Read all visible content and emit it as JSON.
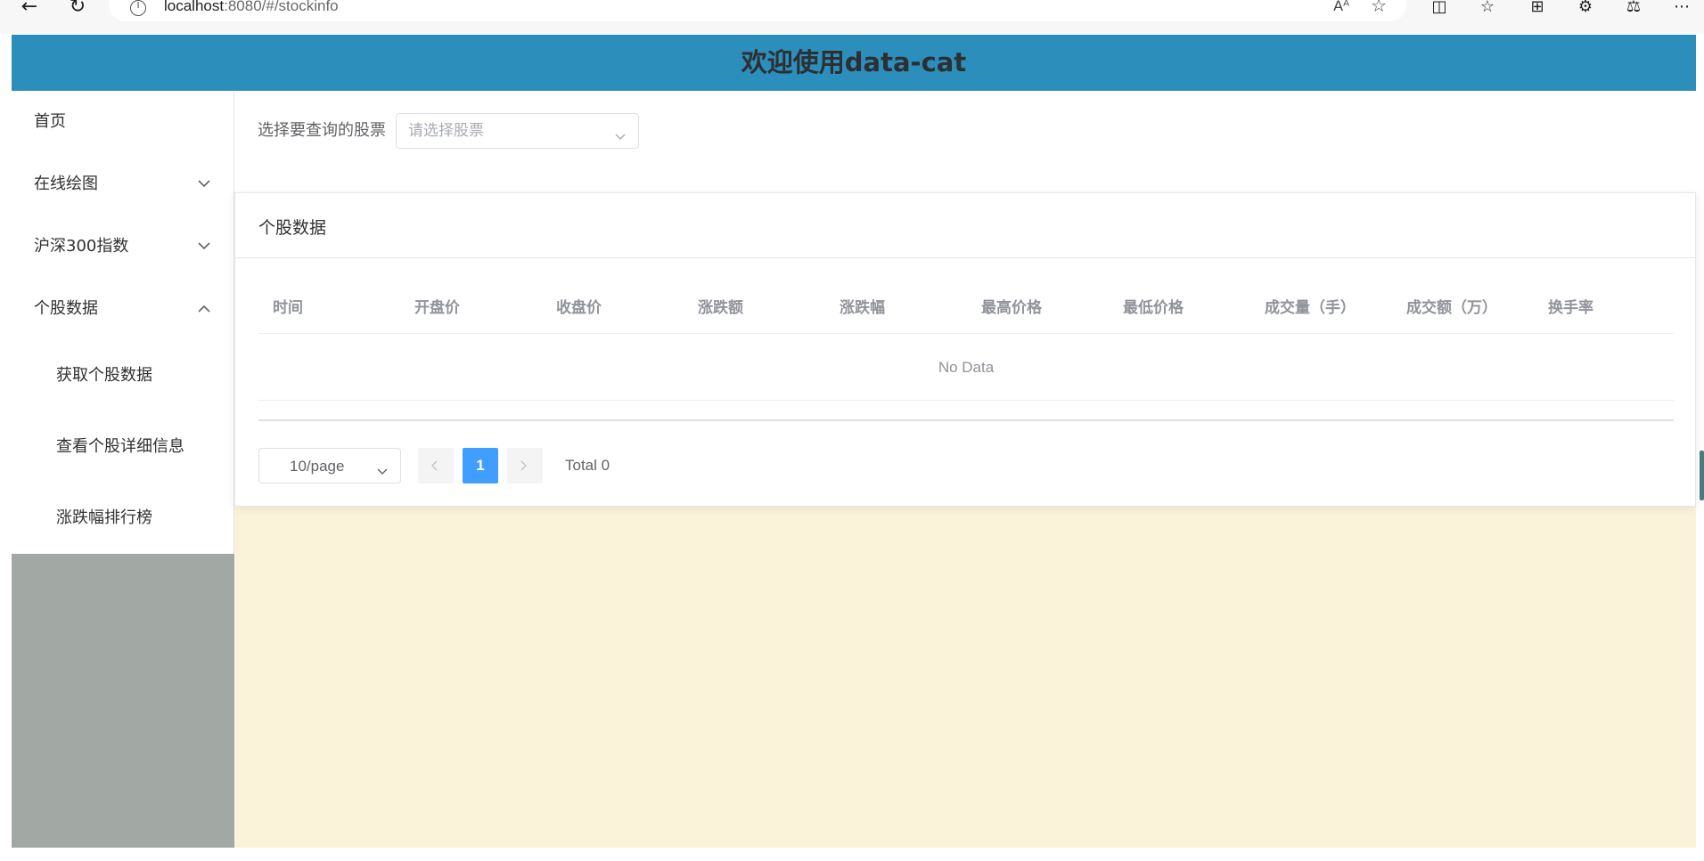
{
  "browser": {
    "url_host": "localhost",
    "url_rest": ":8080/#/stockinfo",
    "icons": [
      "back-icon",
      "refresh-icon",
      "info-icon",
      "read-aloud-icon",
      "favorite-star-icon",
      "split-screen-icon",
      "favorites-list-icon",
      "collections-icon",
      "extensions-icon",
      "browser-essentials-icon",
      "more-icon"
    ],
    "read_aloud": "Aᴬ"
  },
  "header": {
    "title": "欢迎使用data-cat"
  },
  "sidebar": {
    "items": [
      {
        "label": "首页",
        "chevron": "none"
      },
      {
        "label": "在线绘图",
        "chevron": "down"
      },
      {
        "label": "沪深300指数",
        "chevron": "down"
      },
      {
        "label": "个股数据",
        "chevron": "up"
      }
    ],
    "sub_items": [
      {
        "label": "获取个股数据"
      },
      {
        "label": "查看个股详细信息"
      },
      {
        "label": "涨跌幅排行榜"
      }
    ]
  },
  "filter": {
    "label": "选择要查询的股票",
    "placeholder": "请选择股票"
  },
  "card": {
    "title": "个股数据",
    "columns": [
      "时间",
      "开盘价",
      "收盘价",
      "涨跌额",
      "涨跌幅",
      "最高价格",
      "最低价格",
      "成交量（手）",
      "成交额（万）",
      "换手率"
    ],
    "empty_text": "No Data"
  },
  "pagination": {
    "page_size": "10/page",
    "current_page": "1",
    "total": "Total 0"
  },
  "colors": {
    "header_bg": "#2c8fbb",
    "sidebar_bg": "#a2a8a4",
    "main_bg": "#faf3da",
    "accent": "#409eff"
  }
}
